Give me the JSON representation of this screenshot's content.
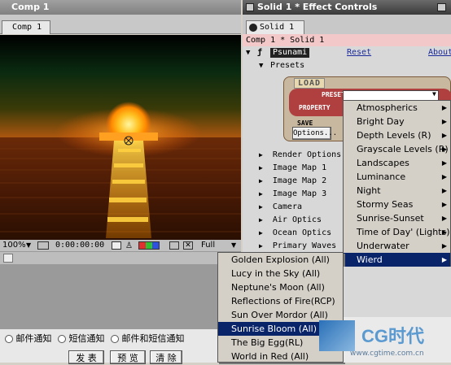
{
  "comp_window": {
    "title": "Comp 1",
    "tab": "Comp 1",
    "zoom": "100%",
    "timecode": "0:00:00:00",
    "resolution": "Full"
  },
  "effect_controls": {
    "title": "Solid 1 * Effect Controls",
    "tab": "Solid 1",
    "breadcrumb": "Comp 1 * Solid 1",
    "effect_name": "Psunami",
    "reset_label": "Reset",
    "about_label": "About",
    "presets_label": "Presets",
    "load_label": "LOAD",
    "preset_label": "PRESET",
    "property_label": "PROPERTY",
    "save_label": "SAVE",
    "options_label": "Options...",
    "groups": [
      "Render Options",
      "Image Map 1",
      "Image Map 2",
      "Image Map 3",
      "Camera",
      "Air Optics",
      "Ocean Optics",
      "Primary Waves"
    ]
  },
  "preset_menu": {
    "items": [
      {
        "label": "Atmospherics"
      },
      {
        "label": "Bright Day"
      },
      {
        "label": "Depth Levels (R)"
      },
      {
        "label": "Grayscale Levels (R)"
      },
      {
        "label": "Landscapes"
      },
      {
        "label": "Luminance"
      },
      {
        "label": "Night"
      },
      {
        "label": "Stormy Seas"
      },
      {
        "label": "Sunrise-Sunset"
      },
      {
        "label": "Time of Day' (Lights)"
      },
      {
        "label": "Underwater"
      },
      {
        "label": "Wierd"
      }
    ]
  },
  "submenu": {
    "items": [
      {
        "label": "Golden Explosion (All)"
      },
      {
        "label": "Lucy in the Sky (All)"
      },
      {
        "label": "Neptune's Moon (All)"
      },
      {
        "label": "Reflections of Fire(RCP)"
      },
      {
        "label": "Sun Over Mordor (All)"
      },
      {
        "label": "Sunrise Bloom (All)"
      },
      {
        "label": "The Big Egg(RL)"
      },
      {
        "label": "World in Red (All)"
      }
    ]
  },
  "page_form": {
    "radio1": "邮件通知",
    "radio2": "短信通知",
    "radio3": "邮件和短信通知",
    "btn_publish": "发 表",
    "btn_preview": "预 览",
    "btn_clear": "清 除"
  },
  "watermark": {
    "brand": "CG时代",
    "url": "www.cgtime.com.cn"
  }
}
